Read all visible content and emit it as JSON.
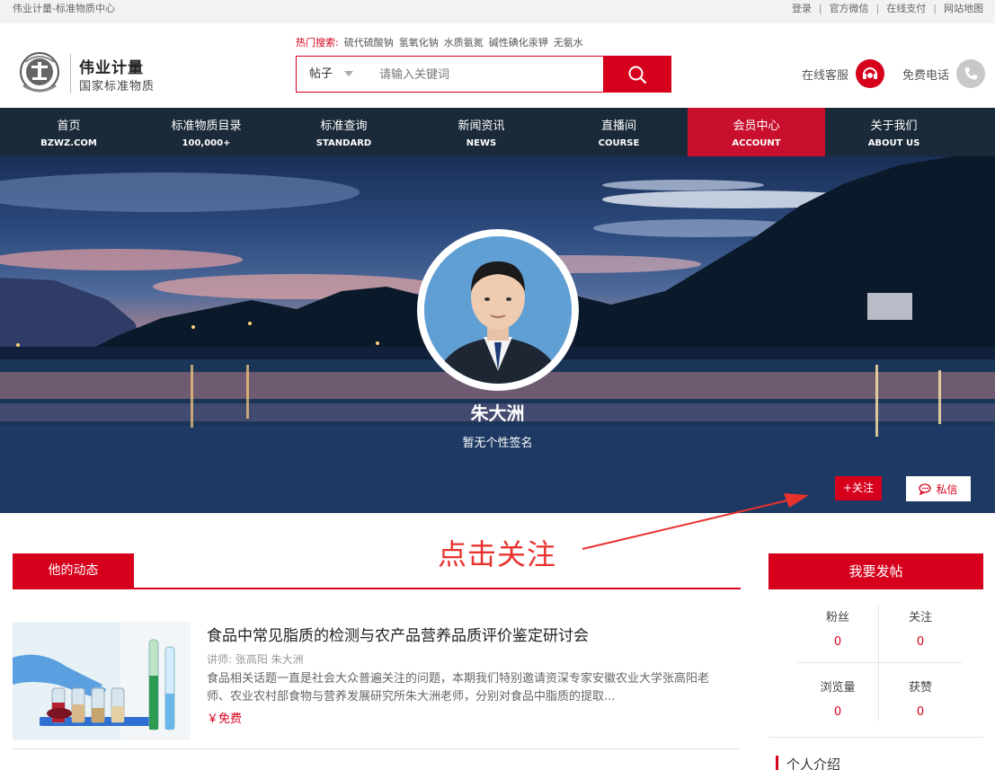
{
  "topbar": {
    "site_name": "伟业计量-标准物质中心",
    "links": [
      "登录",
      "官方微信",
      "在线支付",
      "网站地图"
    ]
  },
  "header": {
    "brand": "伟业计量",
    "brand_sub": "国家标准物质",
    "hot_label": "热门搜索:",
    "hot_terms": [
      "硫代硫酸钠",
      "氢氧化钠",
      "水质氨氮",
      "碱性碘化汞钾",
      "无氨水"
    ],
    "search_category": "帖子",
    "search_placeholder": "请输入关键词",
    "service_online": "在线客服",
    "service_phone": "免费电话"
  },
  "nav": [
    {
      "zh": "首页",
      "en": "BZWZ.COM"
    },
    {
      "zh": "标准物质目录",
      "en": "100,000+"
    },
    {
      "zh": "标准查询",
      "en": "STANDARD"
    },
    {
      "zh": "新闻资讯",
      "en": "NEWS"
    },
    {
      "zh": "直播间",
      "en": "COURSE"
    },
    {
      "zh": "会员中心",
      "en": "ACCOUNT"
    },
    {
      "zh": "关于我们",
      "en": "ABOUT US"
    }
  ],
  "nav_active_index": 5,
  "profile": {
    "name": "朱大洲",
    "signature": "暂无个性签名",
    "follow_label": "+关注",
    "message_label": "私信"
  },
  "annotation": "点击关注",
  "activity": {
    "tab_label": "他的动态",
    "posts": [
      {
        "title": "食品中常见脂质的检测与农产品营养品质评价鉴定研讨会",
        "lecturer": "讲师:   张高阳 朱大洲",
        "description": "食品相关话题一直是社会大众普遍关注的问题，本期我们特别邀请资深专家安徽农业大学张高阳老师、农业农村部食物与营养发展研究所朱大洲老师，分别对食品中脂质的提取...",
        "price": "￥免费"
      }
    ]
  },
  "sidebar": {
    "publish_label": "我要发帖",
    "stats": [
      {
        "label": "粉丝",
        "value": "0"
      },
      {
        "label": "关注",
        "value": "0"
      },
      {
        "label": "浏览量",
        "value": "0"
      },
      {
        "label": "获赞",
        "value": "0"
      }
    ],
    "intro_title": "个人介绍"
  },
  "colors": {
    "brand_red": "#d6001c",
    "nav_bg": "#1b2a38",
    "annotation_red": "#e8322e"
  }
}
